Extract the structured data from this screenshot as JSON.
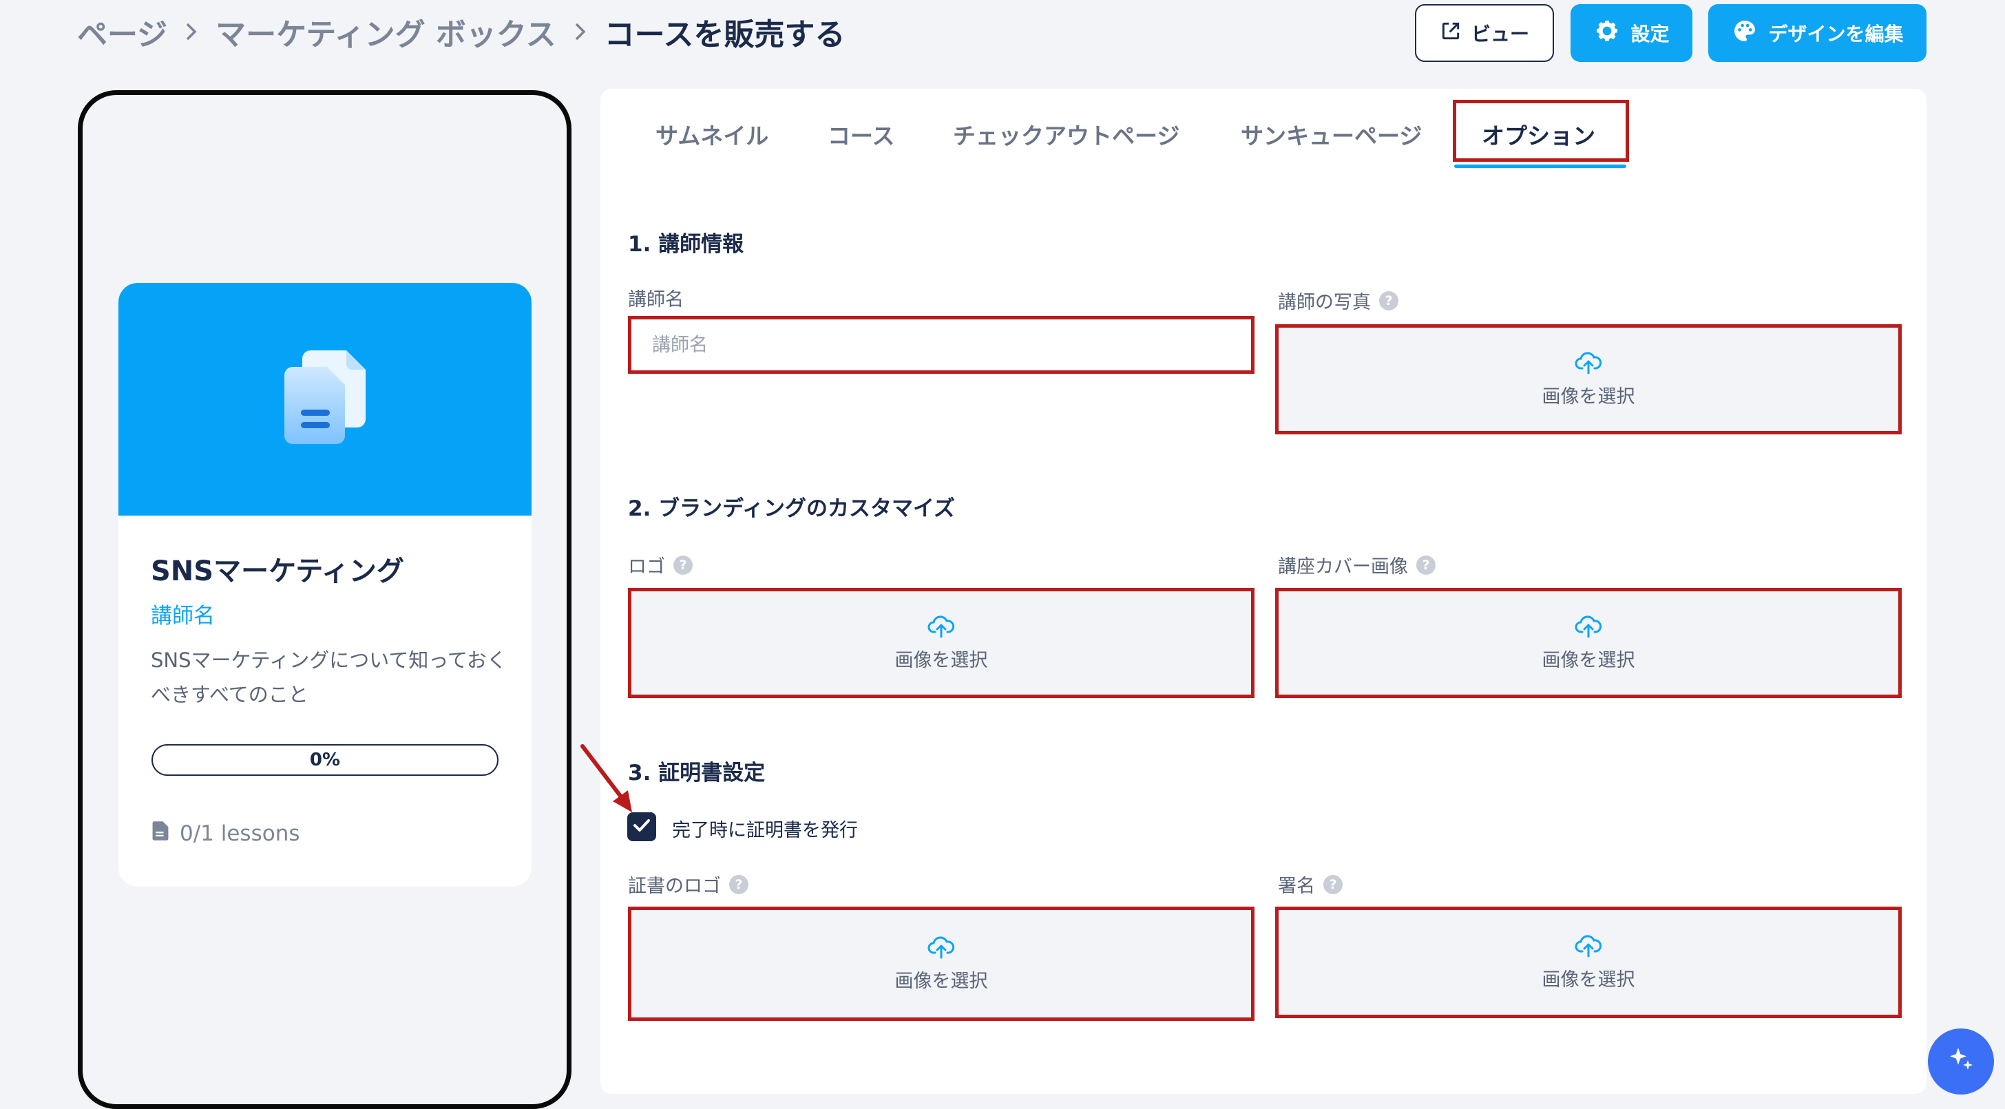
{
  "breadcrumb": {
    "items": [
      "ページ",
      "マーケティング ボックス",
      "コースを販売する"
    ]
  },
  "header": {
    "view_label": "ビュー",
    "settings_label": "設定",
    "design_label": "デザインを編集"
  },
  "preview": {
    "course_title": "SNSマーケティング",
    "instructor": "講師名",
    "description": "SNSマーケティングについて知っておくべきすべてのこと",
    "progress": "0%",
    "lessons": "0/1 lessons"
  },
  "tabs": [
    "サムネイル",
    "コース",
    "チェックアウトページ",
    "サンキューページ",
    "オプション"
  ],
  "active_tab": "オプション",
  "sections": {
    "instructor": {
      "title": "1. 講師情報",
      "name_label": "講師名",
      "name_placeholder": "講師名",
      "photo_label": "講師の写真",
      "photo_upload": "画像を選択"
    },
    "branding": {
      "title": "2. ブランディングのカスタマイズ",
      "logo_label": "ロゴ",
      "logo_upload": "画像を選択",
      "cover_label": "講座カバー画像",
      "cover_upload": "画像を選択"
    },
    "certificate": {
      "title": "3. 証明書設定",
      "checkbox_label": "完了時に証明書を発行",
      "checked": true,
      "logo_label": "証書のロゴ",
      "logo_upload": "画像を選択",
      "signature_label": "署名",
      "signature_upload": "画像を選択"
    }
  },
  "colors": {
    "accent": "#0ea5f5",
    "navy": "#1b2a4a",
    "highlight": "#b91c1c",
    "hero": "#05a3f7"
  }
}
